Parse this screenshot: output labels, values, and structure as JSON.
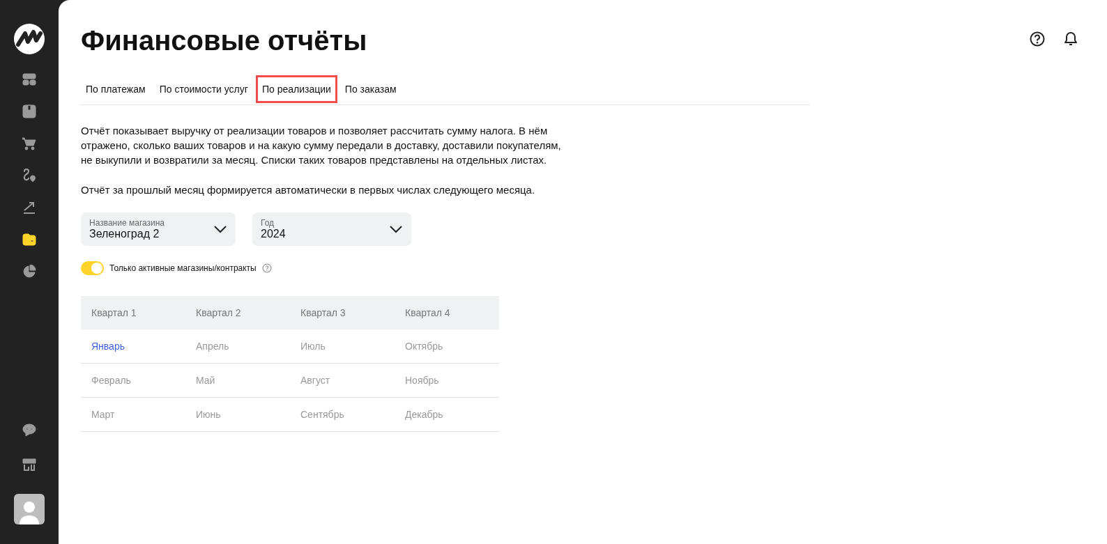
{
  "sidebar": {
    "items": [
      {
        "kind": "dashboard",
        "selected": false
      },
      {
        "kind": "box",
        "selected": false
      },
      {
        "kind": "cart",
        "selected": false
      },
      {
        "kind": "route",
        "selected": false
      },
      {
        "kind": "growth",
        "selected": false
      },
      {
        "kind": "wallet",
        "selected": true
      },
      {
        "kind": "pie",
        "selected": false
      }
    ],
    "bottom_items": [
      {
        "kind": "chat"
      },
      {
        "kind": "store"
      }
    ]
  },
  "title": "Финансовые отчёты",
  "tabs": [
    {
      "label": "По платежам",
      "selected": false
    },
    {
      "label": "По стоимости услуг",
      "selected": false
    },
    {
      "label": "По реализации",
      "selected": true
    },
    {
      "label": "По заказам",
      "selected": false
    }
  ],
  "description": [
    "Отчёт показывает выручку от реализации товаров и позволяет рассчитать сумму налога. В нём отражено, сколько ваших товаров и на какую сумму передали в доставку, доставили покупателям, не выкупили и возвратили за месяц. Списки таких товаров представлены на отдельных листах.",
    "Отчёт за прошлый месяц формируется автоматически в первых числах следующего месяца."
  ],
  "selects": [
    {
      "label": "Название магазина",
      "value": "Зеленоград 2"
    },
    {
      "label": "Год",
      "value": "2024"
    }
  ],
  "toggle": {
    "label": "Только активные магазины/контракты",
    "on": true
  },
  "table": {
    "columns": [
      "Квартал 1",
      "Квартал 2",
      "Квартал 3",
      "Квартал 4"
    ],
    "rows": [
      [
        {
          "text": "Январь",
          "disabled": false
        },
        {
          "text": "Апрель",
          "disabled": true
        },
        {
          "text": "Июль",
          "disabled": true
        },
        {
          "text": "Октябрь",
          "disabled": true
        }
      ],
      [
        {
          "text": "Февраль",
          "disabled": true
        },
        {
          "text": "Май",
          "disabled": true
        },
        {
          "text": "Август",
          "disabled": true
        },
        {
          "text": "Ноябрь",
          "disabled": true
        }
      ],
      [
        {
          "text": "Март",
          "disabled": true
        },
        {
          "text": "Июнь",
          "disabled": true
        },
        {
          "text": "Сентябрь",
          "disabled": true
        },
        {
          "text": "Декабрь",
          "disabled": true
        }
      ]
    ]
  }
}
